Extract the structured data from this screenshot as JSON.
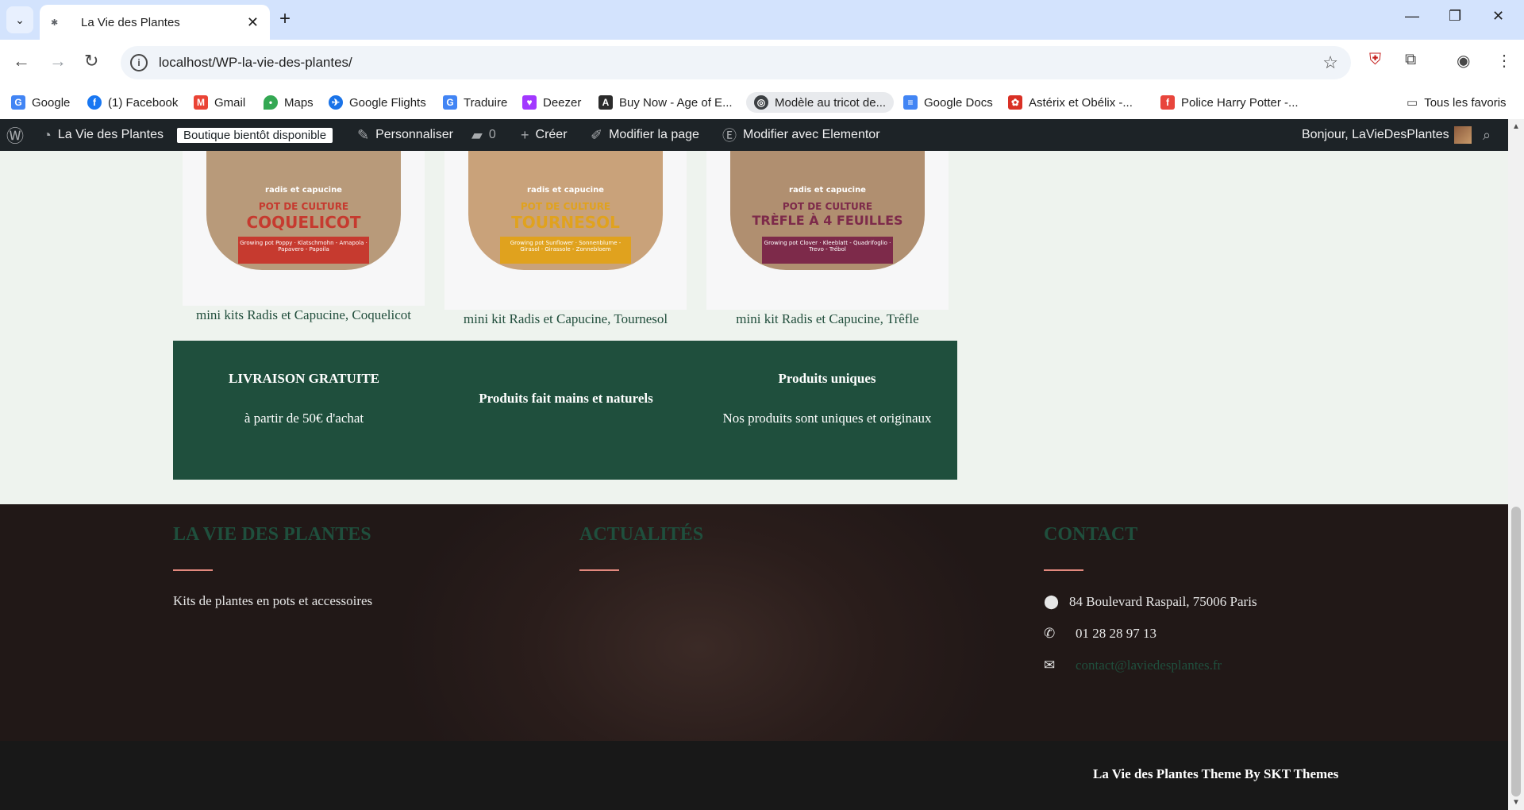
{
  "browser": {
    "tab_title": "La Vie des Plantes",
    "url": "localhost/WP-la-vie-des-plantes/",
    "bookmarks": [
      {
        "label": "Google",
        "icon": "google-icon",
        "color": "#4285f4"
      },
      {
        "label": "(1) Facebook",
        "icon": "facebook-icon",
        "color": "#1877f2"
      },
      {
        "label": "Gmail",
        "icon": "gmail-icon",
        "color": "#ea4335"
      },
      {
        "label": "Maps",
        "icon": "maps-icon",
        "color": "#34a853"
      },
      {
        "label": "Google Flights",
        "icon": "flights-icon",
        "color": "#1a73e8"
      },
      {
        "label": "Traduire",
        "icon": "translate-icon",
        "color": "#4285f4"
      },
      {
        "label": "Deezer",
        "icon": "deezer-icon",
        "color": "#a238ff"
      },
      {
        "label": "Buy Now - Age of E...",
        "icon": "age-of-empires-icon",
        "color": "#2b2b2b"
      },
      {
        "label": "Modèle au tricot de...",
        "icon": "knit-icon",
        "color": "#3c4043"
      },
      {
        "label": "Google Docs",
        "icon": "docs-icon",
        "color": "#4285f4"
      },
      {
        "label": "Astérix et Obélix -...",
        "icon": "asterix-icon",
        "color": "#d93025"
      },
      {
        "label": "Police Harry Potter -...",
        "icon": "font-icon",
        "color": "#e8453c"
      }
    ],
    "all_bookmarks": "Tous les favoris"
  },
  "wp_admin": {
    "site_name": "La Vie des Plantes",
    "badge": "Boutique bientôt disponible",
    "customize": "Personnaliser",
    "comments_count": "0",
    "new": "Créer",
    "edit_page": "Modifier la page",
    "elementor": "Modifier avec Elementor",
    "greeting": "Bonjour, LaVieDesPlantes"
  },
  "products": [
    {
      "brand": "radis et capucine",
      "line1": "POT DE CULTURE",
      "line2": "COQUELICOT",
      "sub": "Growing pot Poppy · Klatschmohn - Amapola · Papavero - Papoila",
      "color": "#c63a2f",
      "caption": "mini kits Radis et Capucine, Coquelicot"
    },
    {
      "brand": "radis et capucine",
      "line1": "POT DE CULTURE",
      "line2": "TOURNESOL",
      "sub": "Growing pot Sunflower · Sonnenblume - Girasol · Girassole - Zonnebloem",
      "color": "#e0a21e",
      "caption": "mini kit Radis et Capucine, Tournesol"
    },
    {
      "brand": "radis et capucine",
      "line1": "POT DE CULTURE",
      "line2": "TRÈFLE À 4 FEUILLES",
      "sub": "Growing pot Clover · Kleeblatt - Quadrifoglio · Trevo - Trébol",
      "color": "#7d2a4a",
      "caption": "mini kit Radis et Capucine, Trêfle"
    }
  ],
  "features": [
    {
      "title": "LIVRAISON GRATUITE",
      "subtitle": "à partir de 50€ d'achat"
    },
    {
      "title": "Produits fait mains et naturels",
      "subtitle": ""
    },
    {
      "title": "Produits uniques",
      "subtitle": "Nos produits sont uniques et originaux"
    }
  ],
  "footer": {
    "col1_title": "LA VIE DES PLANTES",
    "col1_text": "Kits de plantes en pots et accessoires",
    "col2_title": "ACTUALITÉS",
    "col3_title": "CONTACT",
    "address": "84 Boulevard Raspail, 75006 Paris",
    "phone": "01 28 28 97 13",
    "email": "contact@laviedesplantes.fr",
    "credit": "La Vie des Plantes Theme By SKT Themes"
  },
  "colors": {
    "brand_green": "#1f4f3d",
    "accent_line": "#e3897e",
    "wp_bar": "#1d2327"
  }
}
